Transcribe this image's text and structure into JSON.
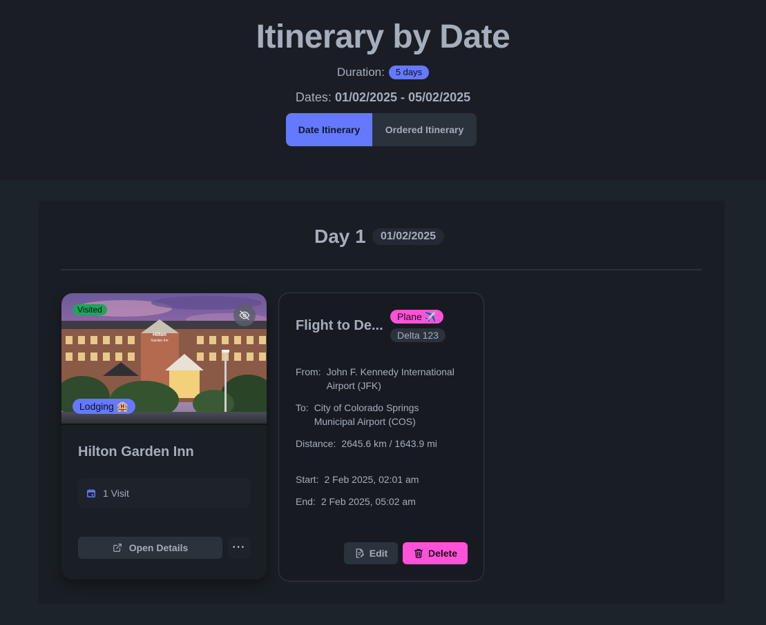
{
  "header": {
    "title": "Itinerary by Date",
    "duration_label": "Duration:",
    "duration_value": "5 days",
    "dates_label": "Dates:",
    "dates_value": "01/02/2025 - 05/02/2025",
    "tabs": [
      {
        "label": "Date Itinerary",
        "active": true
      },
      {
        "label": "Ordered Itinerary",
        "active": false
      }
    ]
  },
  "day": {
    "title": "Day 1",
    "date": "01/02/2025"
  },
  "lodging": {
    "visited_badge": "Visited",
    "type_badge": "Lodging 🏨",
    "sign_text": "Hilton Garden Inn",
    "name": "Hilton Garden Inn",
    "visits": "1 Visit",
    "open_details_label": "Open Details",
    "more_label": "···"
  },
  "transport": {
    "name": "Flight to De...",
    "type_badge": "Plane ✈️",
    "flight_number": "Delta 123",
    "from_label": "From:",
    "from_value_1": "John F. Kennedy International",
    "from_value_2": "Airport (JFK)",
    "to_label": "To:",
    "to_value_1": "City of Colorado Springs",
    "to_value_2": "Municipal Airport (COS)",
    "distance_label": "Distance:",
    "distance_value": "2645.6 km / 1643.9 mi",
    "start_label": "Start:",
    "start_value": "2 Feb 2025, 02:01 am",
    "end_label": "End:",
    "end_value": "2 Feb 2025, 05:02 am",
    "edit_label": "Edit",
    "delete_label": "Delete"
  },
  "colors": {
    "primary": "#6479ff",
    "secondary": "#ff52d9",
    "success": "#22a35a",
    "base": "#1d232a"
  }
}
